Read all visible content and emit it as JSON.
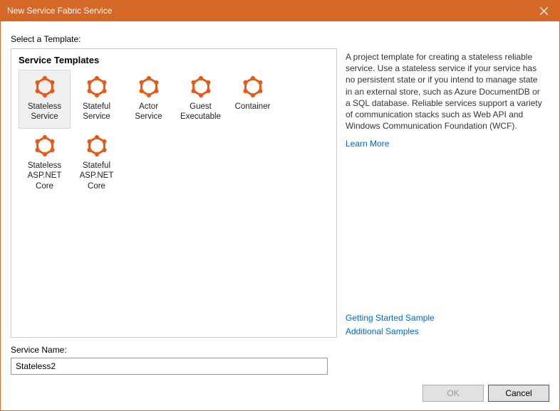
{
  "titlebar": {
    "title": "New Service Fabric Service"
  },
  "body": {
    "select_label": "Select a Template:",
    "templates_title": "Service Templates",
    "templates": [
      {
        "label": "Stateless Service",
        "selected": true
      },
      {
        "label": "Stateful Service",
        "selected": false
      },
      {
        "label": "Actor Service",
        "selected": false
      },
      {
        "label": "Guest Executable",
        "selected": false
      },
      {
        "label": "Container",
        "selected": false
      },
      {
        "label": "Stateless ASP.NET Core",
        "selected": false
      },
      {
        "label": "Stateful ASP.NET Core",
        "selected": false
      }
    ],
    "description": "A project template for creating a stateless reliable service. Use a stateless service if your service has no persistent state or if you intend to manage state in an external store, such as Azure DocumentDB or a SQL database. Reliable services support a variety of communication stacks such as Web API and Windows Communication Foundation (WCF).",
    "learn_more": "Learn More",
    "getting_started": "Getting Started Sample",
    "additional_samples": "Additional Samples",
    "service_name_label": "Service Name:",
    "service_name_value": "Stateless2",
    "ok_label": "OK",
    "cancel_label": "Cancel"
  },
  "colors": {
    "accent": "#d56826",
    "icon": "#e75a16"
  }
}
